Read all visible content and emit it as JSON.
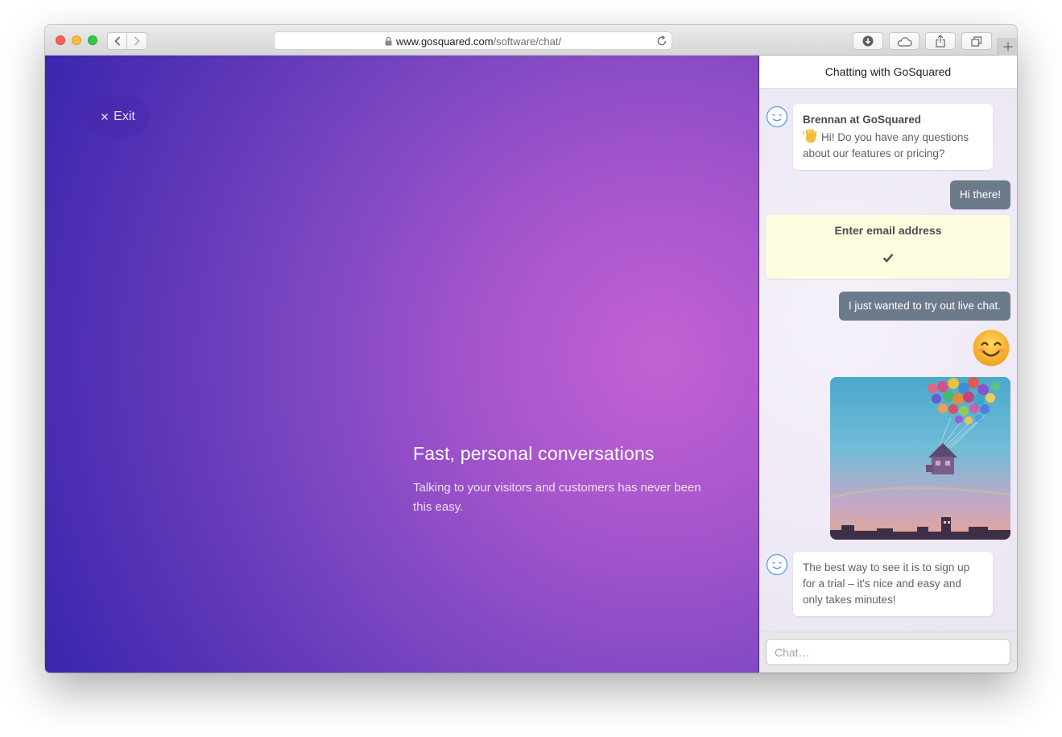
{
  "browser": {
    "url_domain": "www.gosquared.com",
    "url_path": "/software/chat/",
    "icons": {
      "back": "chevron-left-icon",
      "forward": "chevron-right-icon",
      "lock": "lock-icon",
      "reload": "reload-icon",
      "downloads": "download-icon",
      "icloud": "cloud-icon",
      "share": "share-icon",
      "tabs": "tabs-overview-icon",
      "new_tab": "plus-icon"
    }
  },
  "hero": {
    "exit_label": "Exit",
    "title": "Fast, personal conversations",
    "subtitle": "Talking to your visitors and customers has never been this easy."
  },
  "chat": {
    "header_title": "Chatting with GoSquared",
    "messages": [
      {
        "from": "agent",
        "name": "Brennan at GoSquared",
        "text": "Hi! Do you have any questions about our features or pricing?"
      },
      {
        "from": "user",
        "text": "Hi there!"
      },
      {
        "from": "form",
        "label": "Enter email address"
      },
      {
        "from": "user",
        "text": "I just wanted to try out live chat."
      },
      {
        "from": "user",
        "emoji": "smiling-face-emoji"
      },
      {
        "from": "user",
        "image": "balloon-house-photo"
      },
      {
        "from": "agent",
        "text": "The best way to see it is to sign up for a trial – it's nice and easy and only takes minutes!"
      }
    ],
    "input_placeholder": "Chat…"
  },
  "colors": {
    "user_bubble": "#6c7b8a",
    "form_card": "#fefcdf",
    "avatar_stroke": "#5b9be6",
    "hero_gradient": [
      "#3623ae",
      "#c462d4"
    ]
  }
}
